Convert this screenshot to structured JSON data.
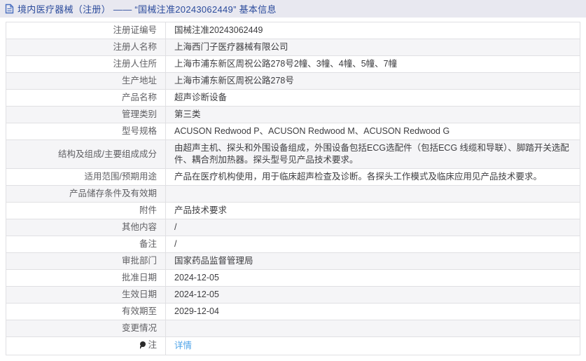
{
  "header": {
    "title": "境内医疗器械（注册） —— “国械注准20243062449” 基本信息",
    "icon": "document-icon",
    "bg_color": "#e8e8f0",
    "text_color": "#2b4b9c"
  },
  "table": {
    "stripe_color": "#f5f5f7",
    "border_color": "#e0e0e3",
    "rows": [
      {
        "label": "注册证编号",
        "value": "国械注准20243062449"
      },
      {
        "label": "注册人名称",
        "value": "上海西门子医疗器械有限公司"
      },
      {
        "label": "注册人住所",
        "value": "上海市浦东新区周祝公路278号2幢、3幢、4幢、5幢、7幢"
      },
      {
        "label": "生产地址",
        "value": "上海市浦东新区周祝公路278号"
      },
      {
        "label": "产品名称",
        "value": "超声诊断设备"
      },
      {
        "label": "管理类别",
        "value": "第三类"
      },
      {
        "label": "型号规格",
        "value": "ACUSON Redwood P、ACUSON Redwood M、ACUSON Redwood G"
      },
      {
        "label": "结构及组成/主要组成成分",
        "value": "由超声主机、探头和外围设备组成，外围设备包括ECG选配件（包括ECG 线缆和导联）、脚踏开关选配件、耦合剂加热器。探头型号见产品技术要求。"
      },
      {
        "label": "适用范围/预期用途",
        "value": "产品在医疗机构使用，用于临床超声检查及诊断。各探头工作模式及临床应用见产品技术要求。"
      },
      {
        "label": "产品储存条件及有效期",
        "value": ""
      },
      {
        "label": "附件",
        "value": "产品技术要求"
      },
      {
        "label": "其他内容",
        "value": "/"
      },
      {
        "label": "备注",
        "value": "/"
      },
      {
        "label": "审批部门",
        "value": "国家药品监督管理局"
      },
      {
        "label": "批准日期",
        "value": "2024-12-05"
      },
      {
        "label": "生效日期",
        "value": "2024-12-05"
      },
      {
        "label": "有效期至",
        "value": "2029-12-04"
      },
      {
        "label": "变更情况",
        "value": ""
      },
      {
        "label": "注",
        "value": "详情",
        "icon": "note-icon",
        "link_color": "#4da3e8"
      }
    ]
  }
}
